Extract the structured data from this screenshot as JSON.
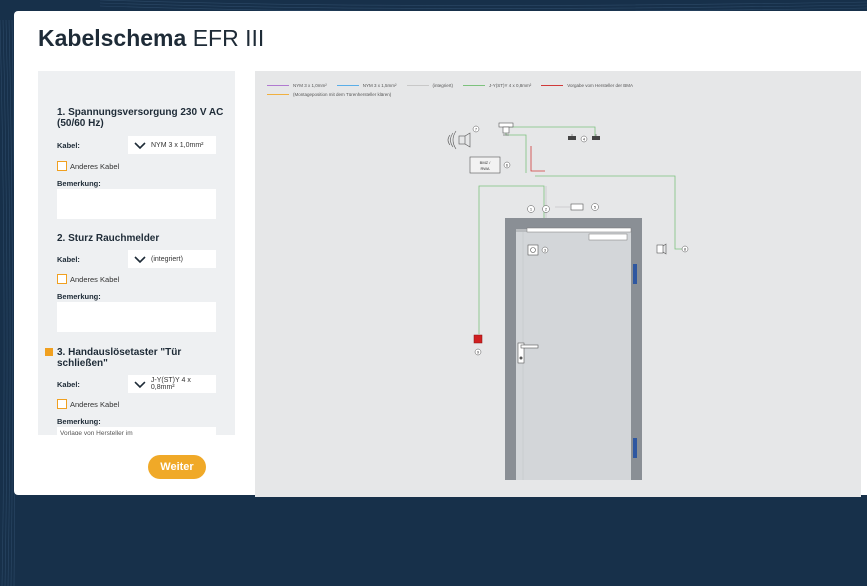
{
  "page": {
    "title_bold": "Kabelschema",
    "title_normal": "EFR III"
  },
  "panel": {
    "sections": [
      {
        "title": "1. Spannungsversorgung 230 V AC (50/60 Hz)",
        "kabel_label": "Kabel:",
        "kabel_value": "NYM 3 x 1,0mm²",
        "other_cable": "Anderes Kabel",
        "remark_label": "Bemerkung:",
        "remark_value": ""
      },
      {
        "title": "2. Sturz Rauchmelder",
        "kabel_label": "Kabel:",
        "kabel_value": "(integriert)",
        "other_cable": "Anderes Kabel",
        "remark_label": "Bemerkung:",
        "remark_value": ""
      },
      {
        "title": "3. Handauslösetaster \"Tür schließen\"",
        "kabel_label": "Kabel:",
        "kabel_value": "J-Y(ST)Y 4 x 0,8mm²",
        "other_cable": "Anderes Kabel",
        "remark_label": "Bemerkung:",
        "remark_value": "Vorlage von Hersteller im"
      }
    ],
    "next_button": "Weiter"
  },
  "diagram": {
    "legend": [
      {
        "label": "NYM 3 x 1,0mm²",
        "color": "#b07ad0"
      },
      {
        "label": "NYM 3 x 1,5mm²",
        "color": "#5aaee8"
      },
      {
        "label": "(integriert)",
        "color": "#c8c8c8"
      },
      {
        "label": "J-Y(ST)Y 4 x 0,8mm²",
        "color": "#7dc27d"
      },
      {
        "label": "Vorgabe vom Hersteller der BMA",
        "color": "#d03a3a"
      },
      {
        "label": "(Montageposition mit dem Türenhersteller klären)",
        "color": "#f0b040"
      }
    ],
    "markers": {
      "m7": "7",
      "m4": "4",
      "m6": "6",
      "m1": "1",
      "m2": "2",
      "m5": "5",
      "m3": "3",
      "m8": "8",
      "m9": "9"
    },
    "bmz_label_1": "BMZ /",
    "bmz_label_2": "RWA"
  },
  "colors": {
    "accent": "#f0a928",
    "background": "#17304a",
    "panel": "#eef0f2",
    "diagram_bg": "#e6e7e8",
    "door_frame": "#8a8f95",
    "door_leaf": "#d3d6d9",
    "green_wire": "#7dc27d",
    "red_wire": "#d03a3a",
    "blue_hinge": "#2f57a0"
  }
}
